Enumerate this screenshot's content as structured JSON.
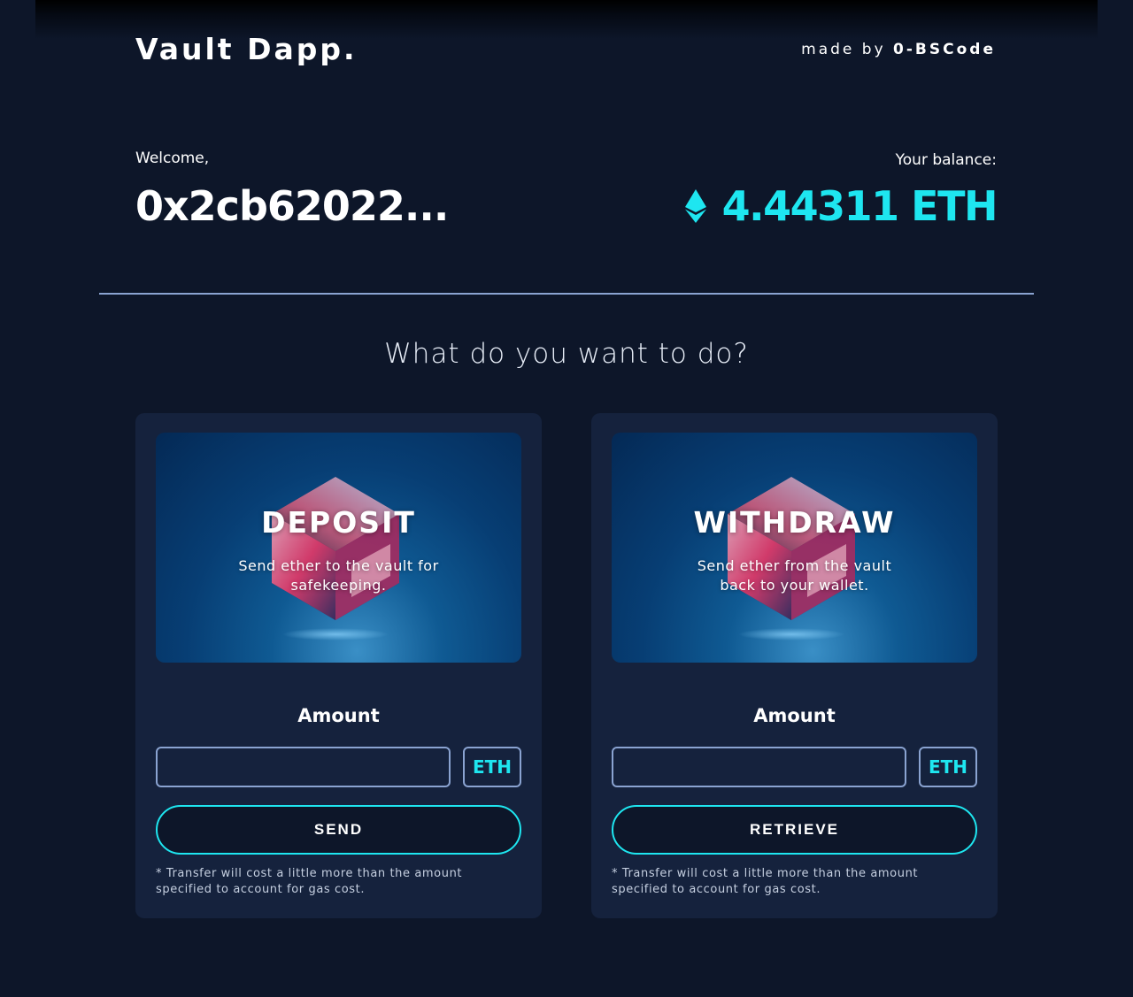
{
  "header": {
    "brand": "Vault Dapp.",
    "made_by_prefix": "made by",
    "made_by_author": "0-BSCode"
  },
  "account": {
    "welcome_label": "Welcome,",
    "address": "0x2cb62022...",
    "balance_label": "Your balance:",
    "balance": "4.44311 ETH"
  },
  "colors": {
    "background": "#0d1629",
    "card": "#15223d",
    "accent": "#1ee6f0",
    "border": "#8aa3d1"
  },
  "question": "What do you want to do?",
  "deposit": {
    "title": "DEPOSIT",
    "subtitle": "Send ether to the vault for safekeeping.",
    "amount_label": "Amount",
    "amount_value": "",
    "unit": "ETH",
    "button": "SEND",
    "note": "* Transfer will cost a little more than the amount specified to account for gas cost."
  },
  "withdraw": {
    "title": "WITHDRAW",
    "subtitle": "Send ether from the vault back to your wallet.",
    "amount_label": "Amount",
    "amount_value": "",
    "unit": "ETH",
    "button": "RETRIEVE",
    "note": "* Transfer will cost a little more than the amount specified to account for gas cost."
  },
  "icons": {
    "balance_icon": "ethereum-icon",
    "hero_image": "crystal-cube-image"
  }
}
